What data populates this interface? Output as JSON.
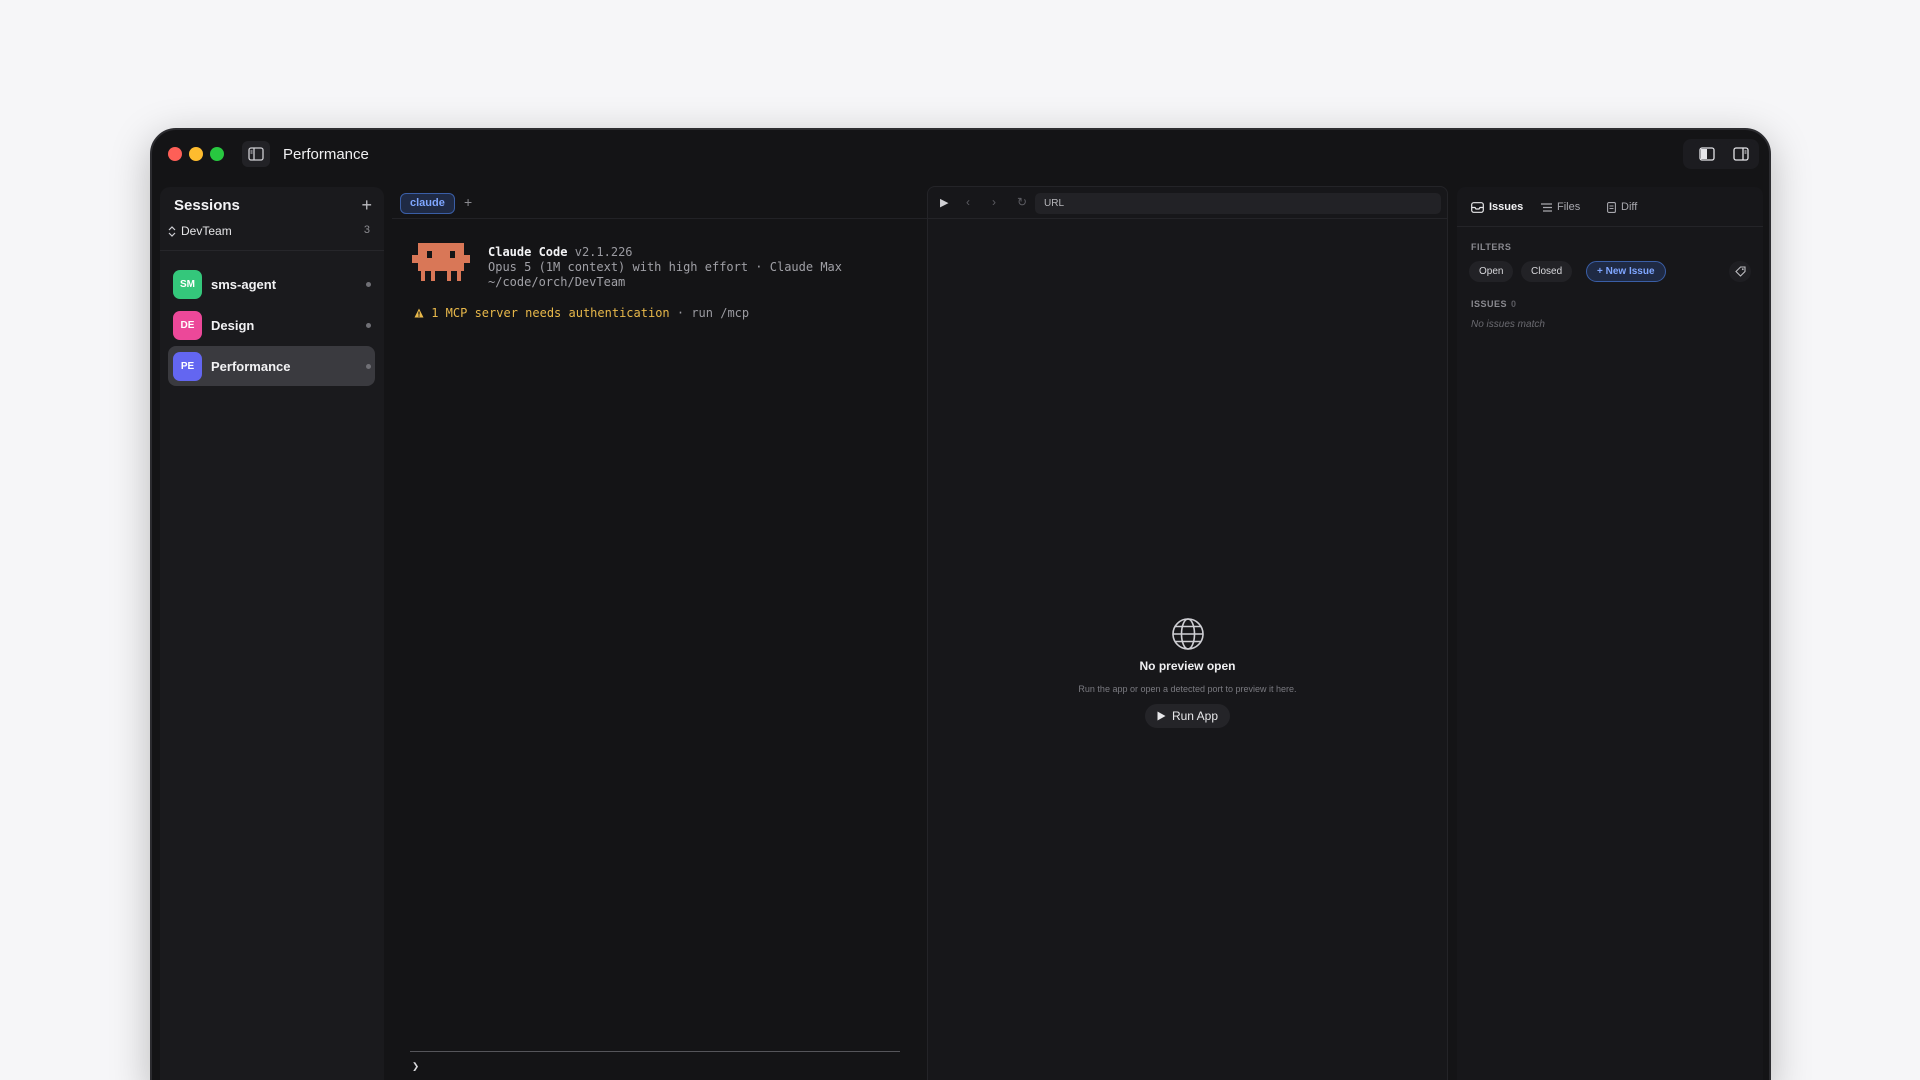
{
  "window": {
    "title": "Performance"
  },
  "sidebar": {
    "title": "Sessions",
    "add_label": "+",
    "team": "DevTeam",
    "count": "3",
    "sessions": [
      {
        "initials": "SM",
        "name": "sms-agent",
        "color": "#34c77b"
      },
      {
        "initials": "DE",
        "name": "Design",
        "color": "#ec4899"
      },
      {
        "initials": "PE",
        "name": "Performance",
        "color": "#6366f1"
      }
    ]
  },
  "terminal": {
    "tab_label": "claude",
    "add_tab": "+",
    "app_name": "Claude Code",
    "version": "v2.1.226",
    "model_line": "Opus 5 (1M context) with high effort · Claude Max",
    "path": "~/code/orch/DevTeam",
    "warning_text": "1 MCP server needs authentication",
    "warning_hint": " · run /mcp",
    "prompt_char": "❯",
    "accent_color": "#d97757"
  },
  "preview": {
    "url_placeholder": "URL",
    "empty_title": "No preview open",
    "empty_subtitle": "Run the app or open a detected port to preview it here.",
    "run_label": "Run App"
  },
  "issues": {
    "tabs": [
      {
        "label": "Issues",
        "icon": "inbox-icon"
      },
      {
        "label": "Files",
        "icon": "list-icon"
      },
      {
        "label": "Diff",
        "icon": "document-icon"
      }
    ],
    "filters_label": "FILTERS",
    "filter_open": "Open",
    "filter_closed": "Closed",
    "new_issue": "+ New Issue",
    "issues_label": "ISSUES",
    "issues_count": "0",
    "empty": "No issues match"
  }
}
